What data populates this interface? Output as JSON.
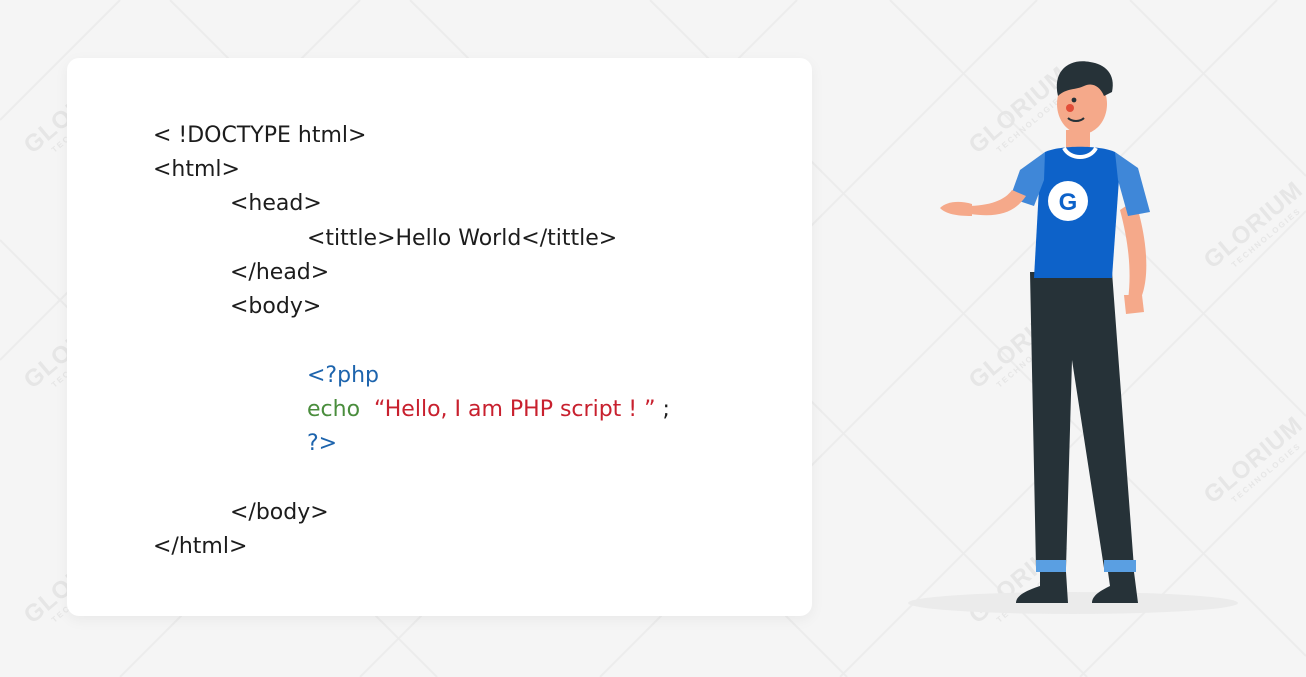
{
  "watermark": {
    "brand": "GLORIUM",
    "sub": "TECHNOLOGIES"
  },
  "code": {
    "lines": [
      "< !DOCTYPE html>",
      "<html>",
      "<head>",
      "<tittle>Hello World</tittle>",
      "</head>",
      "<body>",
      "</body>",
      "</html>"
    ],
    "php_open": "<?php",
    "echo_keyword": "echo",
    "echo_string": "“Hello, I am PHP script ! ”",
    "echo_semicolon": ";",
    "php_close": "?>"
  },
  "illustration": {
    "character": "developer-character",
    "shirt_logo": "G",
    "colors": {
      "shirt": "#0d62c9",
      "sleeve": "#3f87d8",
      "pants": "#263238",
      "skin": "#f5a98a",
      "hair": "#263238",
      "shadow": "#ebebeb"
    }
  },
  "colors": {
    "php_tag": "#1d64ad",
    "keyword": "#4a8d3d",
    "string": "#c8202e",
    "text": "#1c1c1c",
    "background": "#f5f5f5",
    "card": "#ffffff"
  }
}
